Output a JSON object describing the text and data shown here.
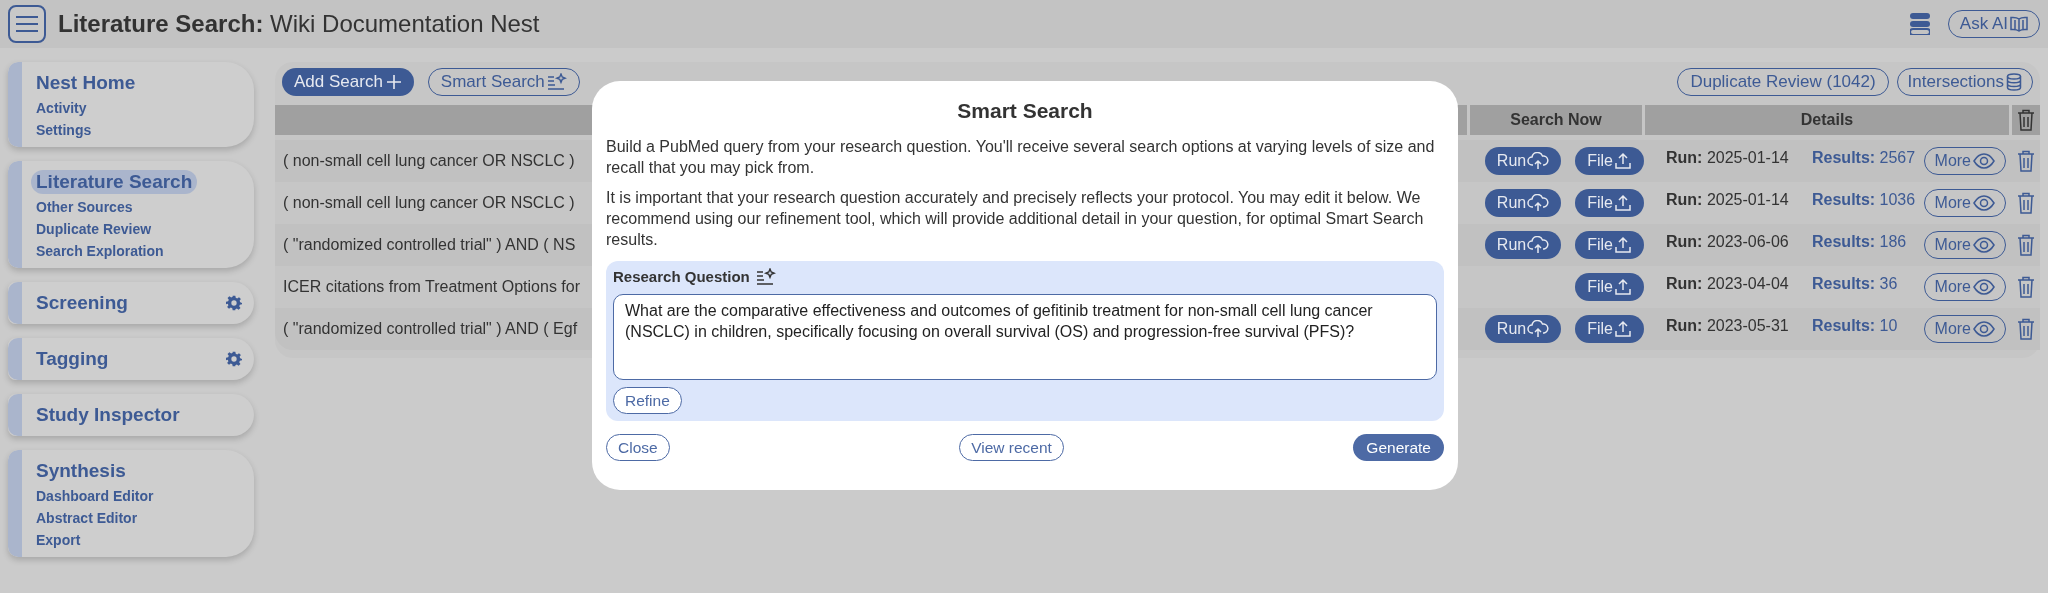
{
  "header": {
    "title_bold": "Literature Search:",
    "title": "Wiki Documentation Nest",
    "ask_ai": "Ask AI"
  },
  "sidebar": [
    {
      "title": "Nest Home",
      "selected": false,
      "settings": false,
      "items": [
        {
          "label": "Activity",
          "selected": false
        },
        {
          "label": "Settings",
          "selected": false
        }
      ]
    },
    {
      "title": "Literature Search",
      "selected": true,
      "settings": false,
      "items": [
        {
          "label": "Other Sources",
          "selected": false
        },
        {
          "label": "Duplicate Review",
          "selected": false
        },
        {
          "label": "Search Exploration",
          "selected": false
        }
      ]
    },
    {
      "title": "Screening",
      "selected": false,
      "settings": true
    },
    {
      "title": "Tagging",
      "selected": false,
      "settings": true
    },
    {
      "title": "Study Inspector",
      "selected": false,
      "settings": false
    },
    {
      "title": "Synthesis",
      "selected": false,
      "settings": false,
      "items": [
        {
          "label": "Dashboard Editor",
          "selected": false
        },
        {
          "label": "Abstract Editor",
          "selected": false
        },
        {
          "label": "Export",
          "selected": false
        }
      ]
    }
  ],
  "toolbar": {
    "add_search": "Add Search",
    "smart_search": "Smart Search",
    "duplicate_review": "Duplicate Review (1042)",
    "intersections": "Intersections"
  },
  "table": {
    "columns": [
      "Search Now",
      "Details"
    ],
    "rows": [
      {
        "query": "( non-small cell lung cancer OR NSCLC )",
        "run": "Run",
        "file": "File",
        "run_label": "Run:",
        "run_date": "2025-01-14",
        "results_label": "Results:",
        "results": "2567",
        "more": "More"
      },
      {
        "query": "( non-small cell lung cancer OR NSCLC )",
        "run": "Run",
        "file": "File",
        "run_label": "Run:",
        "run_date": "2025-01-14",
        "results_label": "Results:",
        "results": "1036",
        "more": "More"
      },
      {
        "query": "( \"randomized controlled trial\" ) AND ( NS",
        "run": "Run",
        "file": "File",
        "run_label": "Run:",
        "run_date": "2023-06-06",
        "results_label": "Results:",
        "results": "186",
        "more": "More"
      },
      {
        "query": "ICER citations from Treatment Options for",
        "file": "File",
        "run_label": "Run:",
        "run_date": "2023-04-04",
        "results_label": "Results:",
        "results": "36",
        "more": "More"
      },
      {
        "query": "( \"randomized controlled trial\" ) AND ( Egf",
        "run": "Run",
        "file": "File",
        "run_label": "Run:",
        "run_date": "2023-05-31",
        "results_label": "Results:",
        "results": "10",
        "more": "More"
      }
    ]
  },
  "dialog": {
    "title": "Smart Search",
    "paragraphs": [
      "Build a PubMed query from your research question. You'll receive several search options at varying levels of size and recall that you may pick from.",
      "It is important that your research question accurately and precisely reflects your protocol. You may edit it below. We recommend using our refinement tool, which will provide additional detail in your question, for optimal Smart Search results."
    ],
    "question_label": "Research Question",
    "question": "What are the comparative effectiveness and outcomes of gefitinib treatment for non-small cell lung cancer (NSCLC) in children, specifically focusing on overall survival (OS) and progression-free survival (PFS)?",
    "refine": "Refine",
    "close": "Close",
    "view_recent": "View recent",
    "generate": "Generate"
  }
}
